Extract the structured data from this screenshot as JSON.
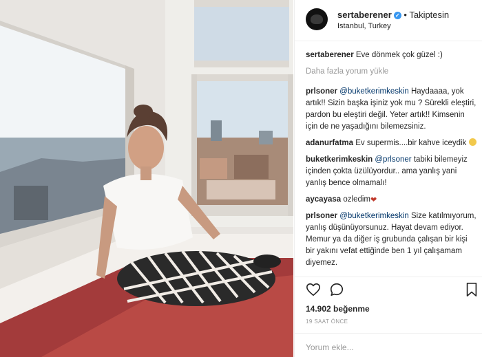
{
  "post": {
    "username": "sertaberener",
    "verified_mark": "✓",
    "follow_label": "• Takiptesin",
    "location": "Istanbul, Turkey"
  },
  "caption": {
    "username": "sertaberener",
    "text": "Eve dönmek çok güzel :)"
  },
  "load_more_label": "Daha fazla yorum yükle",
  "comments": [
    {
      "username": "prlsoner",
      "mention": "@buketkerimkeskin",
      "text": "Haydaaaa, yok artık!! Sizin başka işiniz yok mu ? Sürekli eleştiri, pardon bu eleştiri değil. Yeter artık!! Kimsenin için de ne yaşadığını bilemezsiniz.",
      "emoji": ""
    },
    {
      "username": "adanurfatma",
      "mention": "",
      "text": "Ev supermis....bir kahve iceydik",
      "emoji": "grin-emoji"
    },
    {
      "username": "buketkerimkeskin",
      "mention": "@prlsoner",
      "text": "tabiki bilemeyiz içinden çokta üzülüyordur.. ama yanlış yani yanlış bence olmamalı!",
      "emoji": ""
    },
    {
      "username": "aycayasa",
      "mention": "",
      "text": "ozledim",
      "emoji": "broken-heart-emoji"
    },
    {
      "username": "prlsoner",
      "mention": "@buketkerimkeskin",
      "text": "Size katılmıyorum, yanlış düşünüyorsunuz. Hayat devam ediyor. Memur ya da diğer iş grubunda çalışan bir kişi bir yakını vefat ettiğinde ben 1 yıl çalışamam diyemez.",
      "emoji": ""
    }
  ],
  "icons": {
    "like": "heart-outline-icon",
    "comment": "speech-bubble-icon",
    "save": "bookmark-icon"
  },
  "likes_label": "14.902 beğenme",
  "timestamp": "19 SAAT ÖNCE",
  "comment_input": {
    "placeholder": "Yorum ekle...",
    "value": ""
  },
  "colors": {
    "verified": "#3897f0",
    "mention": "#003569",
    "muted": "#999999",
    "border": "#efefef"
  }
}
